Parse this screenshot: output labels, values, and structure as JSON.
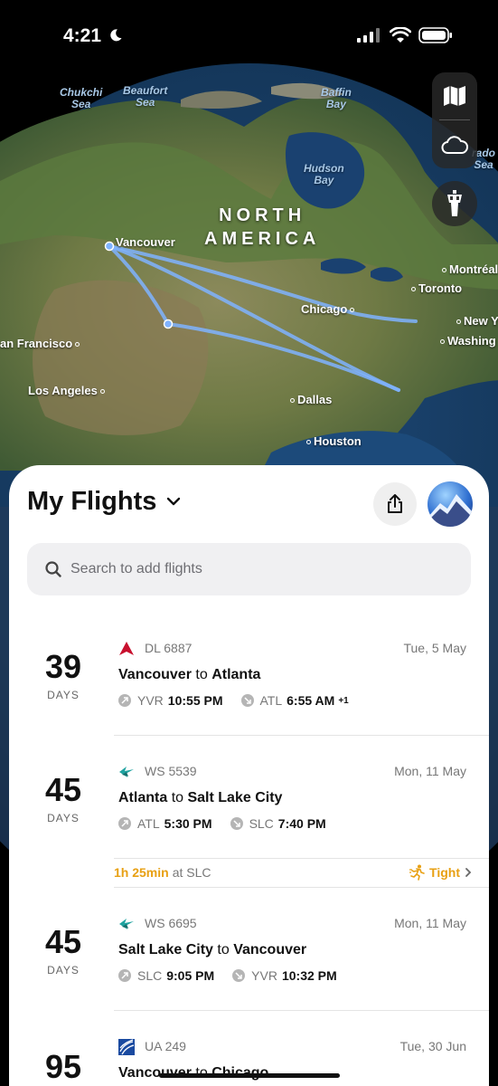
{
  "status_bar": {
    "time": "4:21"
  },
  "map": {
    "seas": [
      {
        "id": "chukchi",
        "text": "Chukchi\nSea"
      },
      {
        "id": "beaufort",
        "text": "Beaufort\nSea"
      },
      {
        "id": "baffin",
        "text": "Baffin\nBay"
      },
      {
        "id": "hudson",
        "text": "Hudson\nBay"
      },
      {
        "id": "labrador",
        "text": "rado\nSea"
      }
    ],
    "continent": "NORTH\nAMERICA",
    "cities": {
      "vancouver": "Vancouver",
      "montreal": "Montréal",
      "toronto": "Toronto",
      "chicago": "Chicago",
      "new_york": "New Y",
      "washington": "Washing",
      "san_francisco": "an Francisco",
      "los_angeles": "Los Angeles",
      "dallas": "Dallas",
      "houston": "Houston"
    },
    "route_color": "#6fa8ff",
    "controls": [
      "map-icon",
      "cloud-icon",
      "control-tower-icon"
    ]
  },
  "sheet": {
    "title": "My Flights",
    "search_placeholder": "Search to add flights",
    "flights": [
      {
        "days": "39",
        "days_label": "DAYS",
        "airline": "delta",
        "code": "DL 6887",
        "date": "Tue, 5 May",
        "from_city": "Vancouver",
        "to_word": "to",
        "to_city": "Atlanta",
        "dep_apt": "YVR",
        "dep_time": "10:55 PM",
        "arr_apt": "ATL",
        "arr_time": "6:55 AM",
        "arr_offset": "+1"
      },
      {
        "days": "45",
        "days_label": "DAYS",
        "airline": "westjet",
        "code": "WS 5539",
        "date": "Mon, 11 May",
        "from_city": "Atlanta",
        "to_word": "to",
        "to_city": "Salt Lake City",
        "dep_apt": "ATL",
        "dep_time": "5:30 PM",
        "arr_apt": "SLC",
        "arr_time": "7:40 PM"
      },
      {
        "days": "45",
        "days_label": "DAYS",
        "airline": "westjet",
        "code": "WS 6695",
        "date": "Mon, 11 May",
        "from_city": "Salt Lake City",
        "to_word": "to",
        "to_city": "Vancouver",
        "dep_apt": "SLC",
        "dep_time": "9:05 PM",
        "arr_apt": "YVR",
        "arr_time": "10:32 PM"
      },
      {
        "days": "95",
        "days_label": "DAYS",
        "airline": "united",
        "code": "UA 249",
        "date": "Tue, 30 Jun",
        "from_city": "Vancouver",
        "to_word": "to",
        "to_city": "Chicago"
      }
    ],
    "layover": {
      "duration": "1h 25min",
      "at": "at SLC",
      "status": "Tight"
    }
  },
  "colors": {
    "accent_orange": "#e8a013",
    "delta_red": "#c8102e",
    "westjet_teal": "#1fa3a0",
    "united_blue": "#1a4aa0"
  }
}
